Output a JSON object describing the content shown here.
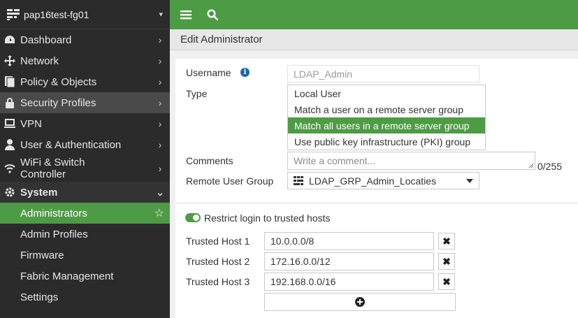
{
  "sidebar": {
    "device_name": "pap16test-fg01",
    "items": [
      {
        "label": "Dashboard",
        "icon": "dashboard-icon"
      },
      {
        "label": "Network",
        "icon": "network-icon"
      },
      {
        "label": "Policy & Objects",
        "icon": "policy-icon"
      },
      {
        "label": "Security Profiles",
        "icon": "lock-icon"
      },
      {
        "label": "VPN",
        "icon": "laptop-icon"
      },
      {
        "label": "User & Authentication",
        "icon": "user-icon"
      },
      {
        "label": "WiFi & Switch Controller",
        "line1": "WiFi & Switch",
        "line2": "Controller",
        "icon": "wifi-icon"
      },
      {
        "label": "System",
        "icon": "gear-icon"
      }
    ],
    "system_items": [
      {
        "label": "Administrators"
      },
      {
        "label": "Admin Profiles"
      },
      {
        "label": "Firmware"
      },
      {
        "label": "Fabric Management"
      },
      {
        "label": "Settings"
      }
    ]
  },
  "page": {
    "title": "Edit Administrator"
  },
  "form": {
    "username_label": "Username",
    "username_value": "LDAP_Admin",
    "type_label": "Type",
    "type_options": [
      "Local User",
      "Match a user on a remote server group",
      "Match all users in a remote server group",
      "Use public key infrastructure (PKI) group"
    ],
    "type_selected_index": 2,
    "comments_label": "Comments",
    "comments_placeholder": "Write a comment...",
    "comments_counter": "0/255",
    "remote_group_label": "Remote User Group",
    "remote_group_value": "LDAP_GRP_Admin_Locaties",
    "restrict_label": "Restrict login to trusted hosts",
    "restrict_enabled": true,
    "trusted_hosts": [
      {
        "label": "Trusted Host 1",
        "value": "10.0.0.0/8"
      },
      {
        "label": "Trusted Host 2",
        "value": "172.16.0.0/12"
      },
      {
        "label": "Trusted Host 3",
        "value": "192.168.0.0/16"
      }
    ]
  },
  "colors": {
    "accent": "#4e9b45",
    "sidebar_bg": "#2b2b2b"
  }
}
